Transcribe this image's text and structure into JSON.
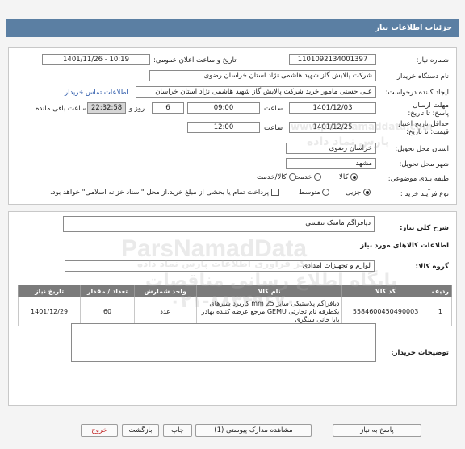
{
  "header": {
    "title": "جزئیات اطلاعات نیاز"
  },
  "form": {
    "need_number_label": "شماره نیاز:",
    "need_number": "1101092134001397",
    "announce_label": "تاریخ و ساعت اعلان عمومی:",
    "announce_value": "1401/11/26 - 10:19",
    "buyer_label": "نام دستگاه خریدار:",
    "buyer_value": "شرکت پالایش گاز شهید هاشمی نژاد   استان خراسان رضوی",
    "creator_label": "ایجاد کننده درخواست:",
    "creator_value": "علی حسنی مامور خرید شرکت پالایش گاز شهید هاشمی نژاد   استان خراسان",
    "contact_link": "اطلاعات تماس خریدار",
    "deadline_label": "مهلت ارسال پاسخ: تا تاریخ:",
    "deadline_date": "1401/12/03",
    "time_label": "ساعت",
    "deadline_time": "09:00",
    "days_value": "6",
    "days_label": "روز و",
    "remaining_time": "22:32:58",
    "remaining_label": "ساعت باقی مانده",
    "validity_label": "حداقل تاریخ اعتبار قیمت: تا تاریخ:",
    "validity_date": "1401/12/25",
    "validity_time_label": "ساعت",
    "validity_time": "12:00",
    "province_label": "استان محل تحویل:",
    "province_value": "خراسان رضوی",
    "city_label": "شهر محل تحویل:",
    "city_value": "مشهد",
    "category_label": "طبقه بندی موضوعی:",
    "category_options": [
      "کالا",
      "خدمت",
      "کالا/خدمت"
    ],
    "process_label": "نوع فرآیند خرید :",
    "process_options": [
      "جزیی",
      "متوسط"
    ],
    "payment_note": "پرداخت تمام یا بخشی از مبلغ خرید،از محل \"اسناد خزانه اسلامی\" خواهد بود."
  },
  "details": {
    "summary_label": "شرح کلی نیاز:",
    "summary_value": "دیافراگم ماسک تنفسی",
    "goods_heading": "اطلاعات کالاهای مورد نیاز",
    "group_label": "گروه کالا:",
    "group_value": "لوازم و تجهیزات امدادی",
    "table": {
      "headers": [
        "ردیف",
        "کد کالا",
        "نام کالا",
        "واحد شمارش",
        "تعداد / مقدار",
        "تاریخ نیاز"
      ],
      "rows": [
        {
          "row": "1",
          "code": "5584600450490003",
          "name": "دیافراگم پلاستیکی سایز 25 mm کاربرد شیرهای یکطرفه نام تجارتی GEMU مرجع عرضه کننده بهادر بابا خانی سنگری",
          "unit": "عدد",
          "qty": "60",
          "date": "1401/12/29"
        }
      ]
    },
    "buyer_notes_label": "توضیحات خریدار:",
    "buyer_notes_value": ""
  },
  "buttons": {
    "reply": "پاسخ به نیاز",
    "attachments": "مشاهده مدارک پیوستی (1)",
    "print": "چاپ",
    "back": "بازگشت",
    "exit": "خروج"
  },
  "watermark": {
    "brand": "ParsNamadData",
    "line1": "پایگاه اطلاع رسانی مناقصات",
    "phone": "۰۲۱-۸۸۳۴۹۶۷۰",
    "logo_text": "www.parsnamaddata.com",
    "site_fa": "پارس نماد داده",
    "note": "مرکز فراوری اطلاعات پارس نماد داده"
  },
  "colors": {
    "header_bg": "#5b7fa3",
    "table_header_bg": "#7b7b7b",
    "link": "#1f4fa5",
    "exit_red": "#c02020"
  }
}
